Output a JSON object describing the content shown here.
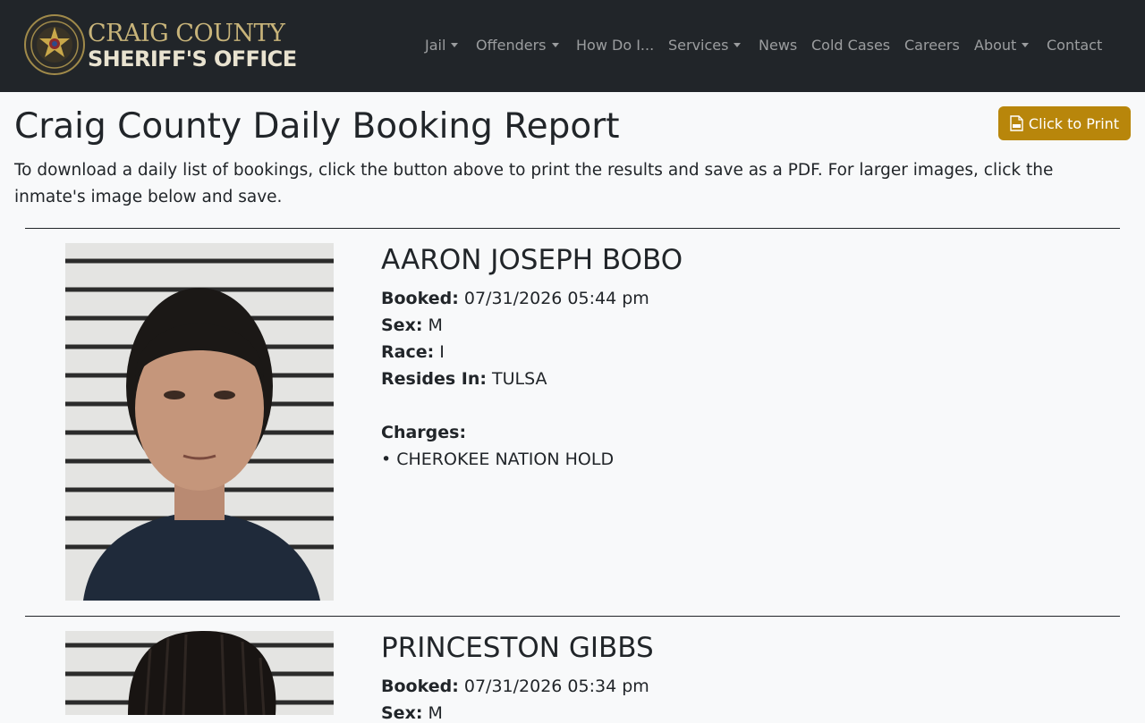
{
  "brand": {
    "line1": "CRAIG COUNTY",
    "line2": "SHERIFF'S OFFICE"
  },
  "nav": {
    "items": [
      {
        "label": "Jail",
        "dropdown": true
      },
      {
        "label": "Offenders",
        "dropdown": true
      },
      {
        "label": "How Do I...",
        "dropdown": false
      },
      {
        "label": "Services",
        "dropdown": true
      },
      {
        "label": "News",
        "dropdown": false
      },
      {
        "label": "Cold Cases",
        "dropdown": false
      },
      {
        "label": "Careers",
        "dropdown": false
      },
      {
        "label": "About",
        "dropdown": true
      },
      {
        "label": "Contact",
        "dropdown": false
      }
    ]
  },
  "page": {
    "title": "Craig County Daily Booking Report",
    "print_label": "Click to Print",
    "intro": "To download a daily list of bookings, click the button above to print the results and save as a PDF. For larger images, click the inmate's image below and save."
  },
  "labels": {
    "booked": "Booked:",
    "sex": "Sex:",
    "race": "Race:",
    "resides": "Resides In:",
    "charges": "Charges:"
  },
  "inmates": [
    {
      "name": "AARON JOSEPH BOBO",
      "booked": "07/31/2026 05:44 pm",
      "sex": "M",
      "race": "I",
      "resides_in": "TULSA",
      "charges": [
        "• CHEROKEE NATION HOLD"
      ]
    },
    {
      "name": "PRINCESTON GIBBS",
      "booked": "07/31/2026 05:34 pm",
      "sex": "M"
    }
  ],
  "colors": {
    "navbar": "#212529",
    "accent": "#b8860b",
    "page_bg": "#f8f9fa"
  }
}
